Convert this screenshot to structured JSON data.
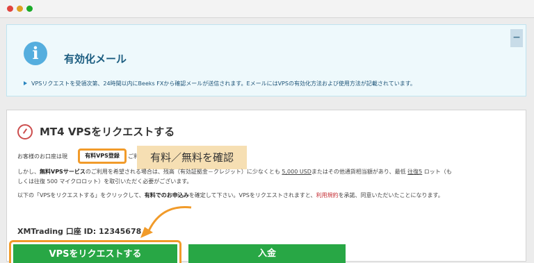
{
  "window": {
    "controls": [
      "close",
      "minimize",
      "zoom"
    ]
  },
  "info": {
    "icon": "info-icon",
    "icon_glyph": "i",
    "title": "有効化メール",
    "collapse_label": "−",
    "message": "VPSリクエストを受領次第、24時間以内にBeeks FXから確認メールが送信されます。EメールにはVPSの有効化方法および使用方法が記載されています。"
  },
  "panel": {
    "icon": "speedometer-icon",
    "title": "MT4 VPSをリクエストする",
    "line1_prefix": "お客様のお口座は現",
    "line1_badge": "有料VPS登録",
    "line1_suffix": "ご利用いただけます。",
    "line2": {
      "a": "しかし、",
      "b": "無料VPSサービス",
      "c": "のご利用を希望される場合は、残高（有効証拠金－クレジット）に少なくとも",
      "d": "5,000 USD",
      "e": "またはその他通貨相当額があり、最低",
      "f": "往復5",
      "g": "ロット（も"
    },
    "line3": "しくは往復 500 マイクロロット）を取引いただく必要がございます。",
    "line4": {
      "a": "以下の「VPSをリクエストする」をクリックして、",
      "b": "有料でのお申込み",
      "c": "を確定して下さい。VPSをリクエストされますと、",
      "d": "利用規約",
      "e": "を承諾、同意いただいたことになります。"
    },
    "account_label": "XMTrading 口座 ID: 12345678",
    "callout": "有料／無料を確認",
    "request_button": "VPSをリクエストする",
    "deposit_button": "入金"
  },
  "colors": {
    "accent_orange": "#f19b2a",
    "button_green": "#28a745",
    "info_title": "#1c5d80",
    "link_red": "#c52f35"
  }
}
